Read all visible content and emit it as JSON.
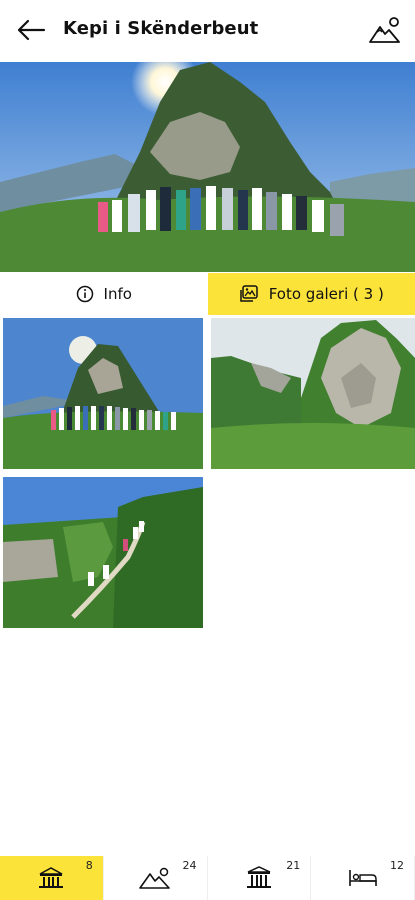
{
  "header": {
    "title": "Kepi i Skënderbeut",
    "back_icon": "arrow-left-icon",
    "map_icon": "mountain-pin-icon"
  },
  "tabs": [
    {
      "label": "Info",
      "icon": "info-circle-icon",
      "active": false
    },
    {
      "label": "Foto galeri ( 3 )",
      "icon": "gallery-icon",
      "active": true
    }
  ],
  "gallery": {
    "images": [
      {
        "subject": "group-at-peak"
      },
      {
        "subject": "rocky-peak-forest"
      },
      {
        "subject": "hikers-on-trail"
      }
    ]
  },
  "bottom_nav": [
    {
      "icon": "museum-icon",
      "count": "8",
      "active": true
    },
    {
      "icon": "mountain-icon",
      "count": "24",
      "active": false
    },
    {
      "icon": "monument-icon",
      "count": "21",
      "active": false
    },
    {
      "icon": "bed-icon",
      "count": "12",
      "active": false
    }
  ],
  "colors": {
    "accent": "#fbe33a",
    "text": "#111111"
  }
}
